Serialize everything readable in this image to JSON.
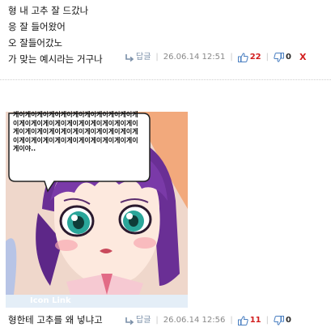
{
  "comment1": {
    "lines": [
      "형 내 고추 잘 드갔나",
      "응 잘 들어왔어",
      "오 잘들어갔노",
      "가 맞는 예시라는 거구나"
    ],
    "reply_label": "답글",
    "date": "26.06.14 12:51",
    "up_count": "22",
    "down_count": "0",
    "delete_label": "X"
  },
  "comment2": {
    "image": {
      "bubble_text": "게이게이게이게이게이게이게이게이게이게이게이게이게이게이게이게이게이게이게이게이게이게이게이게이게이게이게이게이게이게이게이게이게이게이게이게이게이게이게이게이게이게이게이야..",
      "icon_link_label": "Icon Link"
    },
    "text": "형한테 고추를 왜 넣냐고",
    "reply_label": "답글",
    "date": "26.06.14 12:56",
    "up_count": "11",
    "down_count": "0"
  },
  "colors": {
    "up_red": "#d21e1e",
    "reply_blue": "#7a8fa8",
    "thumb_blue": "#4a7fc1"
  }
}
